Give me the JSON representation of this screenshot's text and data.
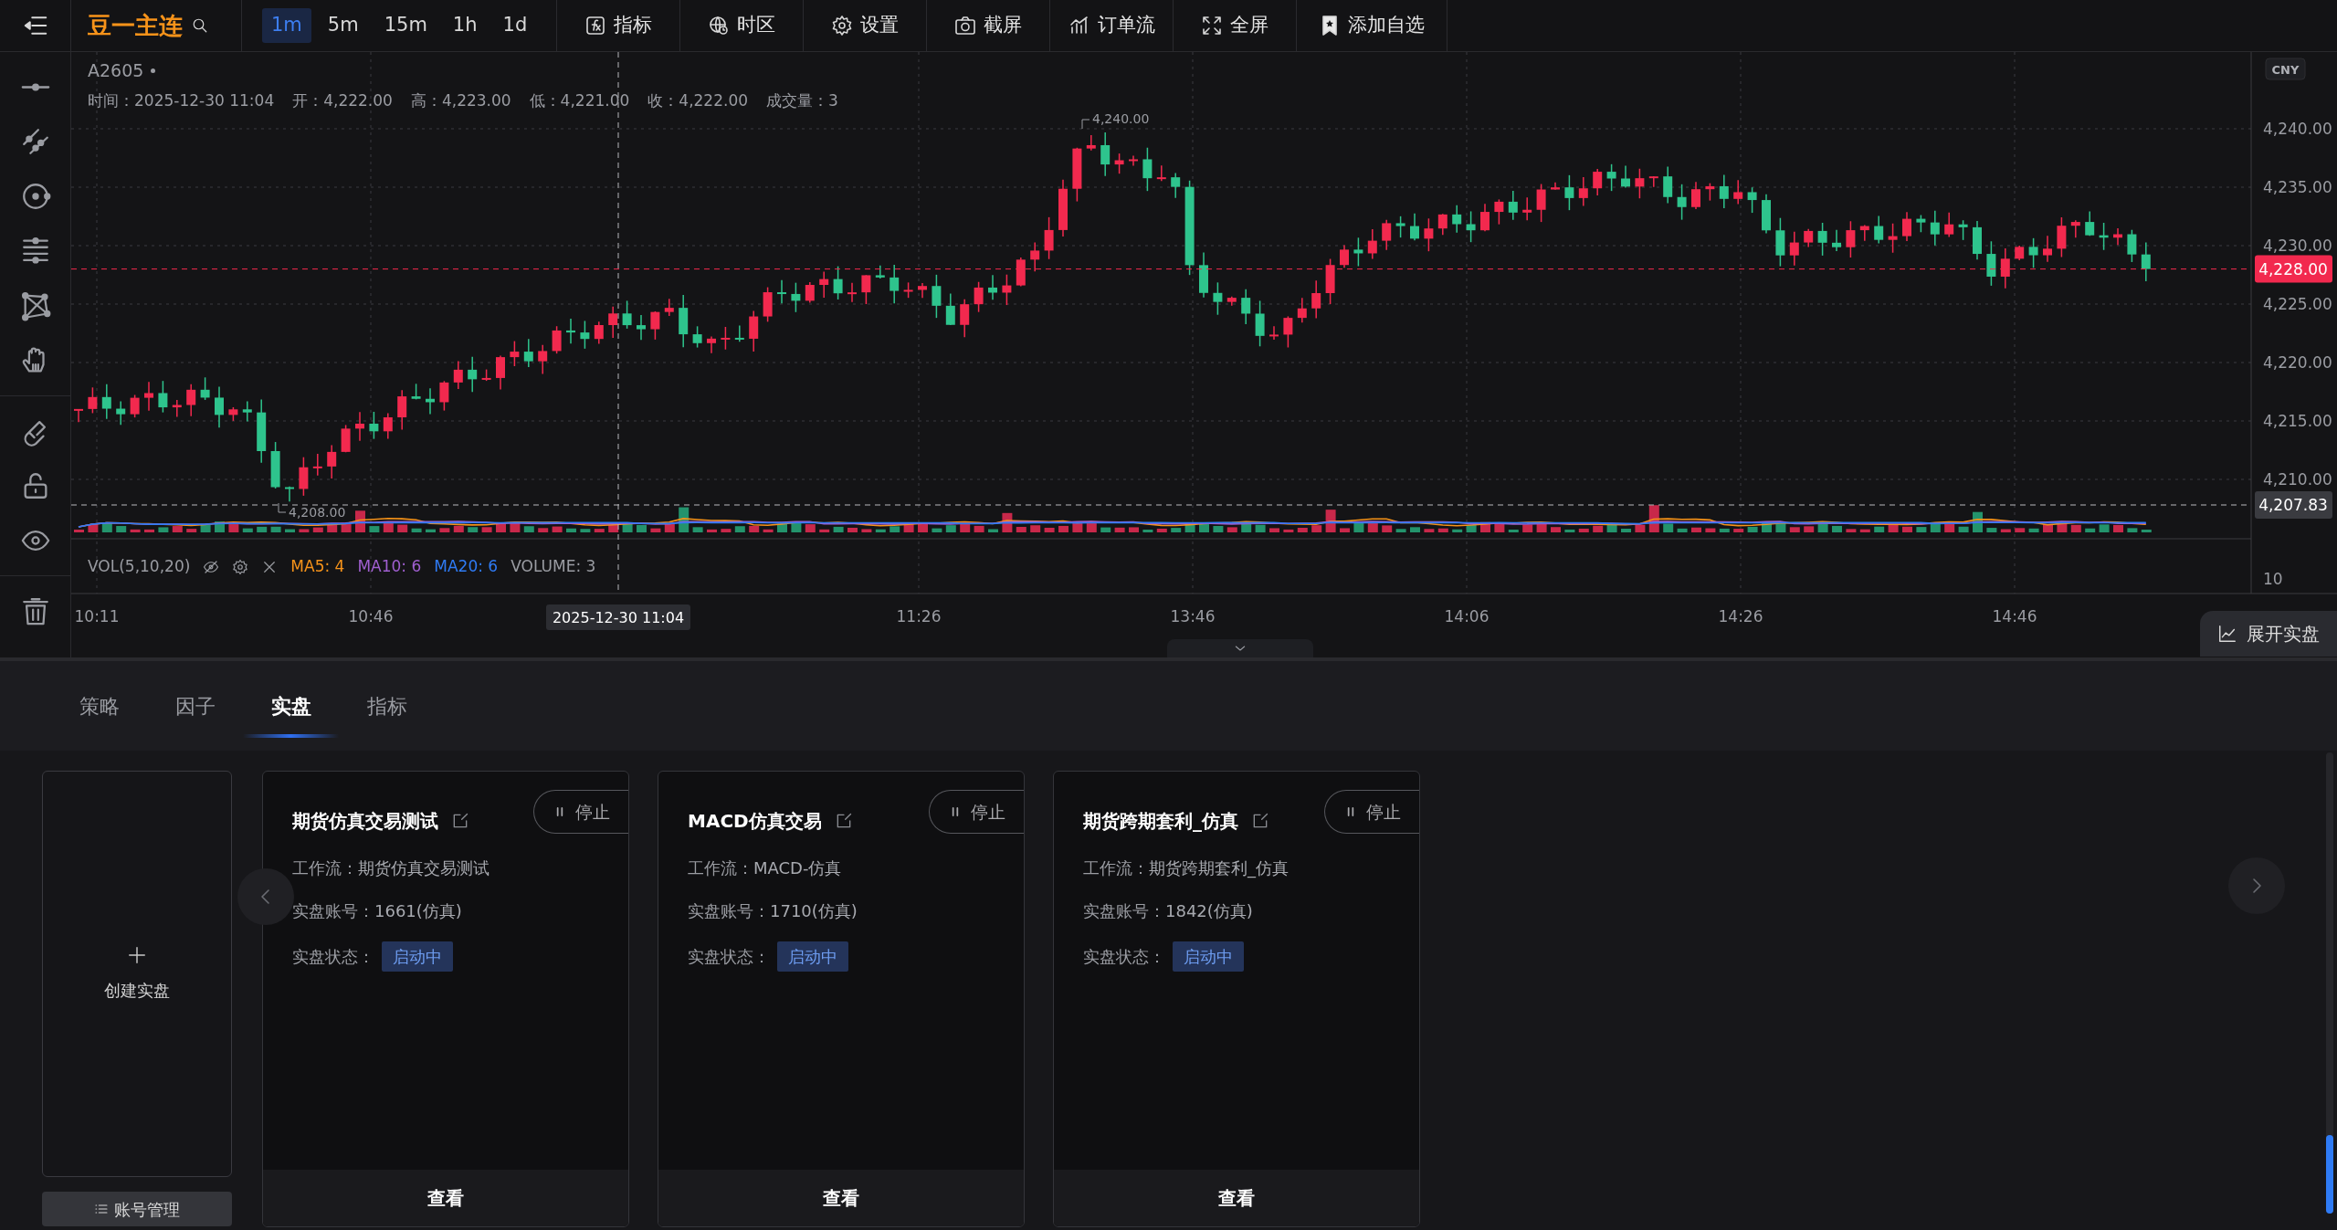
{
  "toolbar": {
    "symbol": "豆一主连",
    "intervals": [
      {
        "label": "1m",
        "selected": true
      },
      {
        "label": "5m",
        "selected": false
      },
      {
        "label": "15m",
        "selected": false
      },
      {
        "label": "1h",
        "selected": false
      },
      {
        "label": "1d",
        "selected": false
      }
    ],
    "buttons": [
      {
        "label": "指标",
        "kind": "indicator"
      },
      {
        "label": "时区",
        "kind": "timezone"
      },
      {
        "label": "设置",
        "kind": "settings"
      },
      {
        "label": "截屏",
        "kind": "screenshot"
      },
      {
        "label": "订单流",
        "kind": "orderflow"
      },
      {
        "label": "全屏",
        "kind": "fullscreen"
      },
      {
        "label": "添加自选",
        "kind": "watchlist"
      }
    ]
  },
  "chart": {
    "symbol": "A2605",
    "info": [
      "时间：2025-12-30 11:04",
      "开：4,222.00",
      "高：4,223.00",
      "低：4,221.00",
      "收：4,222.00",
      "成交量：3"
    ],
    "currency": "CNY",
    "price_ticks": [
      "4,240.00",
      "4,235.00",
      "4,230.00",
      "4,225.00",
      "4,220.00",
      "4,215.00",
      "4,210.00"
    ],
    "last_price": "4,228.00",
    "crosshair_price": "4,207.83",
    "high_label": "4,240.00",
    "low_label": "4,208.00",
    "volume": {
      "title": "VOL(5,10,20)",
      "ma": [
        {
          "label": "MA5: 4",
          "color": "#f7931a"
        },
        {
          "label": "MA10: 6",
          "color": "#a05fd0"
        },
        {
          "label": "MA20: 6",
          "color": "#2f7bf5"
        }
      ],
      "volume_label": "VOLUME: 3",
      "tick": "10"
    },
    "time_ticks": [
      "10:11",
      "10:46",
      "11:26",
      "13:46",
      "14:06",
      "14:26",
      "14:46"
    ],
    "crosshair_time": "2025-12-30 11:04",
    "expand_button": "展开实盘"
  },
  "bottom": {
    "tabs": [
      {
        "label": "策略",
        "selected": false
      },
      {
        "label": "因子",
        "selected": false
      },
      {
        "label": "实盘",
        "selected": true
      },
      {
        "label": "指标",
        "selected": false
      }
    ],
    "create_label": "创建实盘",
    "account_button": "账号管理",
    "cards": [
      {
        "title": "期货仿真交易测试",
        "stop": "停止",
        "fields": [
          {
            "label": "工作流：",
            "value": "期货仿真交易测试"
          },
          {
            "label": "实盘账号：",
            "value": "1661(仿真)"
          }
        ],
        "status_label": "实盘状态：",
        "status": "启动中",
        "view": "查看"
      },
      {
        "title": "MACD仿真交易",
        "stop": "停止",
        "fields": [
          {
            "label": "工作流：",
            "value": "MACD-仿真"
          },
          {
            "label": "实盘账号：",
            "value": "1710(仿真)"
          }
        ],
        "status_label": "实盘状态：",
        "status": "启动中",
        "view": "查看"
      },
      {
        "title": "期货跨期套利_仿真",
        "stop": "停止",
        "fields": [
          {
            "label": "工作流：",
            "value": "期货跨期套利_仿真"
          },
          {
            "label": "实盘账号：",
            "value": "1842(仿真)"
          }
        ],
        "status_label": "实盘状态：",
        "status": "启动中",
        "view": "查看"
      }
    ]
  }
}
